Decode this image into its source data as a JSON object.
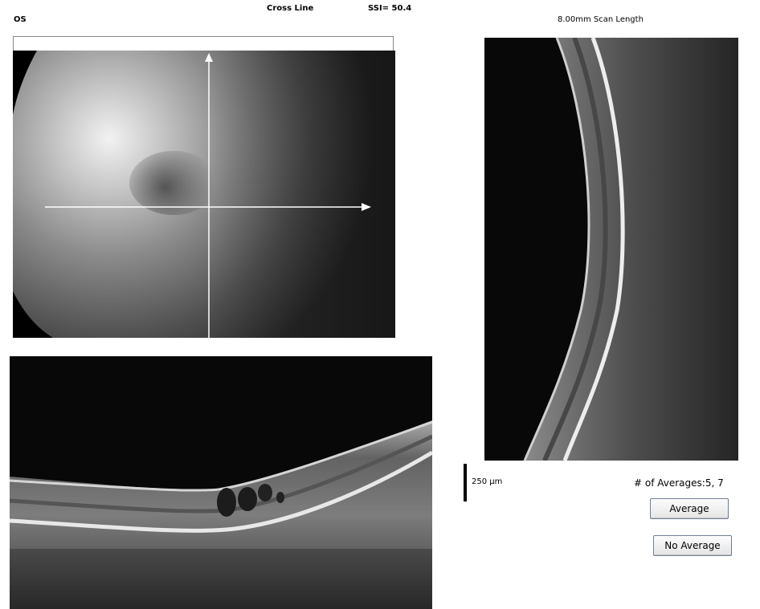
{
  "header": {
    "eye": "OS",
    "scan_type": "Cross Line",
    "ssi": "SSI= 50.4",
    "scan_length": "8.00mm Scan Length"
  },
  "scale": {
    "label": "250 µm"
  },
  "averages": {
    "label": "# of Averages:5, 7",
    "average_button": "Average",
    "no_average_button": "No Average"
  }
}
